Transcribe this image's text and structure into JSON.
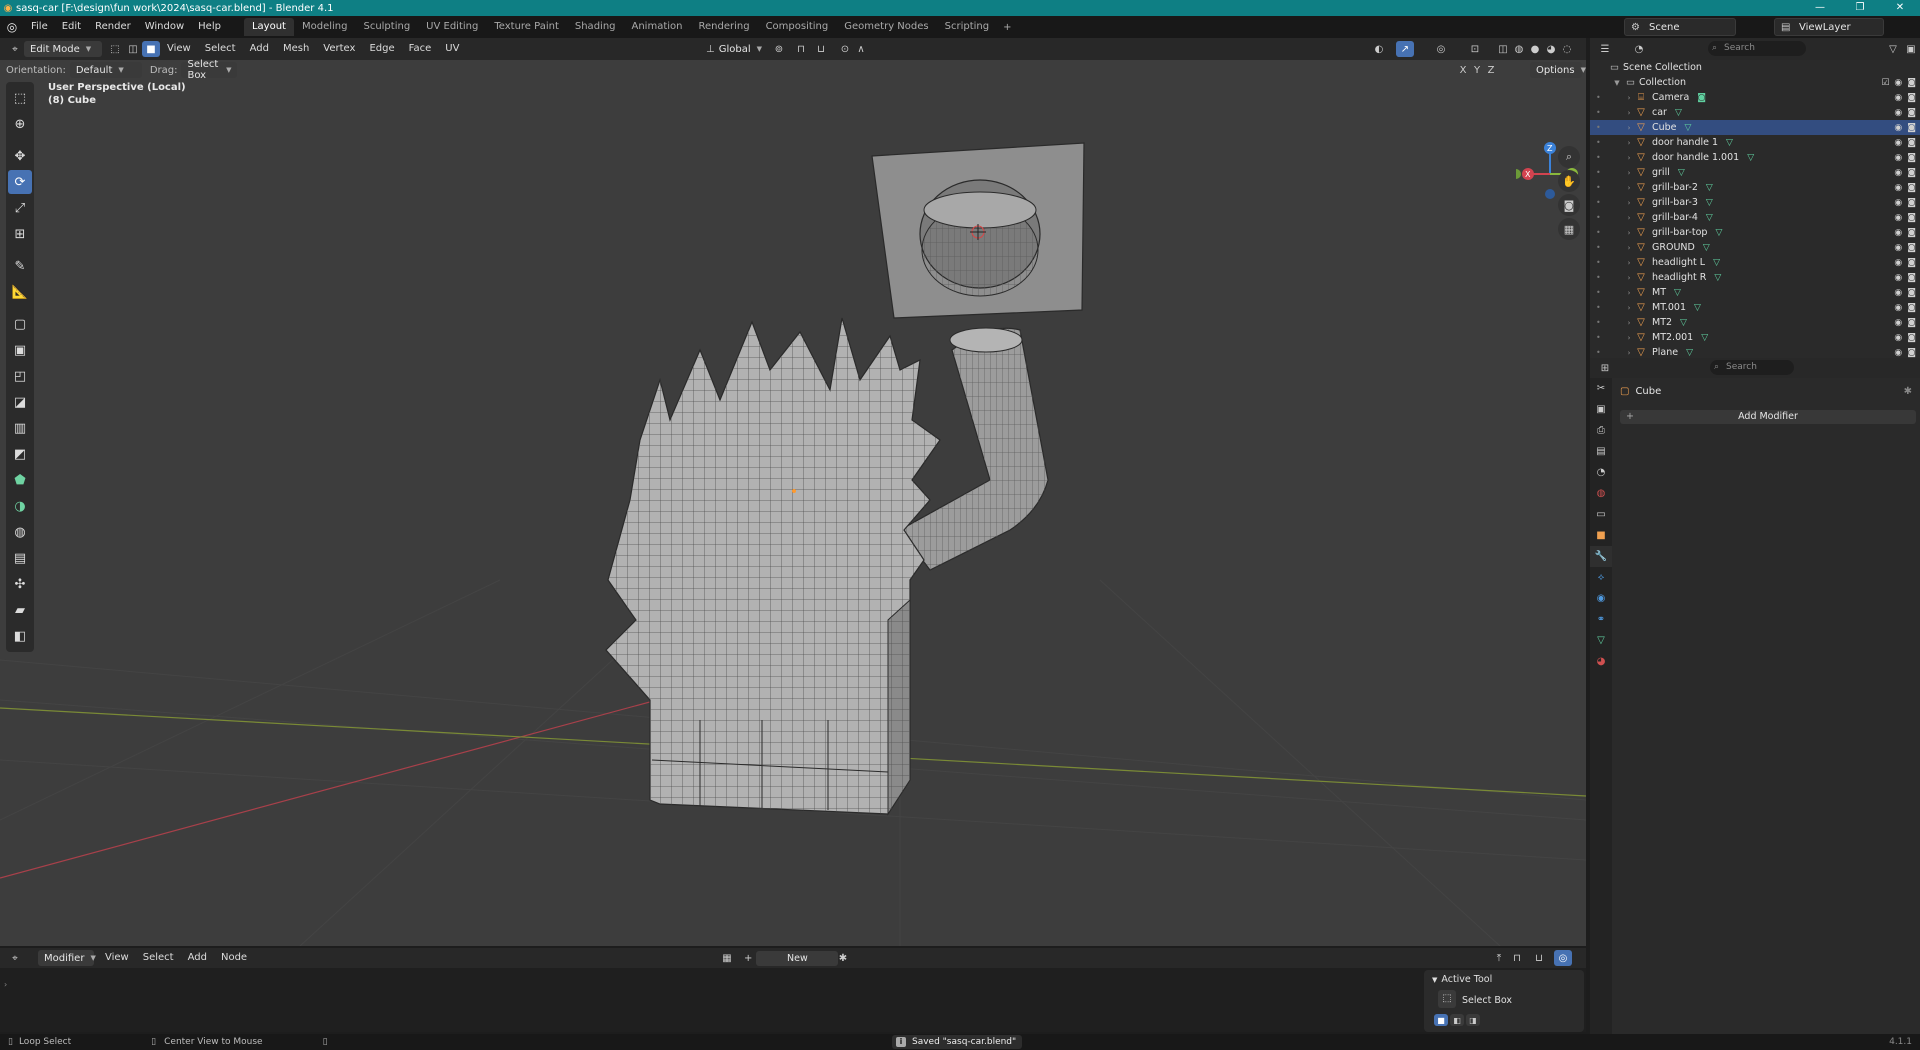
{
  "window": {
    "title": "sasq-car [F:\\design\\fun work\\2024\\sasq-car.blend] - Blender 4.1",
    "controls": [
      "—",
      "❐",
      "✕"
    ]
  },
  "menus": [
    "File",
    "Edit",
    "Render",
    "Window",
    "Help"
  ],
  "workspaces": {
    "tabs": [
      "Layout",
      "Modeling",
      "Sculpting",
      "UV Editing",
      "Texture Paint",
      "Shading",
      "Animation",
      "Rendering",
      "Compositing",
      "Geometry Nodes",
      "Scripting"
    ],
    "active": "Layout",
    "add": "+"
  },
  "scene": {
    "name": "Scene",
    "view_layer": "ViewLayer"
  },
  "viewport_header": {
    "mode": "Edit Mode",
    "menus": [
      "View",
      "Select",
      "Add",
      "Mesh",
      "Vertex",
      "Edge",
      "Face",
      "UV"
    ],
    "transform_space": "Global",
    "orientation_label": "Orientation:",
    "orientation_value": "Default",
    "drag_label": "Drag:",
    "drag_value": "Select Box",
    "options": "Options",
    "axes": [
      "X",
      "Y",
      "Z"
    ]
  },
  "viewport": {
    "info_line1": "User Perspective (Local)",
    "info_line2": "(8) Cube",
    "gizmo_axes": [
      "Z",
      "X",
      "Y"
    ]
  },
  "outliner": {
    "search_placeholder": "Search",
    "root": "Scene Collection",
    "collection": "Collection",
    "items": [
      {
        "name": "Camera",
        "type": "camera",
        "selected": false
      },
      {
        "name": "car",
        "type": "mesh",
        "selected": false
      },
      {
        "name": "Cube",
        "type": "mesh",
        "selected": true
      },
      {
        "name": "door handle 1",
        "type": "mesh",
        "selected": false
      },
      {
        "name": "door handle 1.001",
        "type": "mesh",
        "selected": false
      },
      {
        "name": "grill",
        "type": "mesh",
        "selected": false
      },
      {
        "name": "grill-bar-2",
        "type": "mesh",
        "selected": false
      },
      {
        "name": "grill-bar-3",
        "type": "mesh",
        "selected": false
      },
      {
        "name": "grill-bar-4",
        "type": "mesh",
        "selected": false
      },
      {
        "name": "grill-bar-top",
        "type": "mesh",
        "selected": false
      },
      {
        "name": "GROUND",
        "type": "mesh",
        "selected": false
      },
      {
        "name": "headlight L",
        "type": "mesh",
        "selected": false
      },
      {
        "name": "headlight R",
        "type": "mesh",
        "selected": false
      },
      {
        "name": "MT",
        "type": "mesh",
        "selected": false
      },
      {
        "name": "MT.001",
        "type": "mesh",
        "selected": false
      },
      {
        "name": "MT2",
        "type": "mesh",
        "selected": false
      },
      {
        "name": "MT2.001",
        "type": "mesh",
        "selected": false
      },
      {
        "name": "Plane",
        "type": "mesh",
        "selected": false
      }
    ]
  },
  "properties": {
    "search_placeholder": "Search",
    "object_name": "Cube",
    "add_modifier": "Add Modifier"
  },
  "bottom_editor": {
    "editor_type": "Modifier",
    "menus": [
      "View",
      "Select",
      "Add",
      "Node"
    ],
    "new_button": "New",
    "active_tool_header": "Active Tool",
    "active_tool_name": "Select Box"
  },
  "statusbar": {
    "left1": "Loop Select",
    "left2": "Center View to Mouse",
    "message": "Saved \"sasq-car.blend\"",
    "version": "4.1.1"
  },
  "colors": {
    "titlebar": "#0e7f84",
    "accent": "#4772b3",
    "selected_row": "#334d80",
    "viewport_bg": "#3d3d3d",
    "x_axis": "#d2434f",
    "y_axis": "#8ab83c",
    "z_axis": "#3b82d9"
  }
}
